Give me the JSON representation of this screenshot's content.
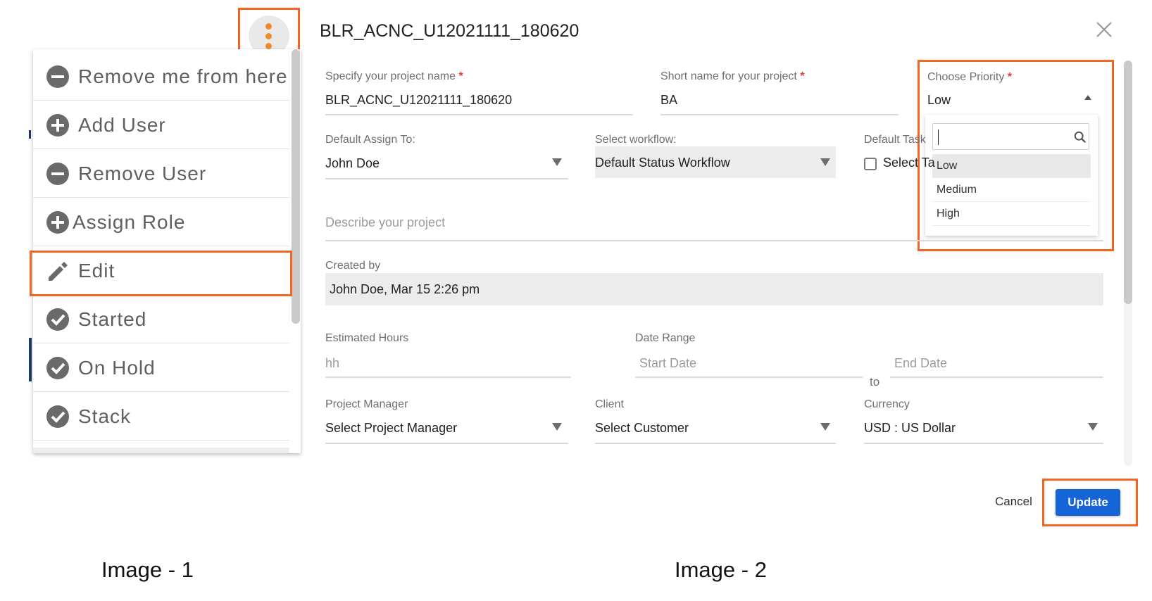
{
  "image1": {
    "caption": "Image - 1",
    "menu": {
      "items": [
        {
          "label": "Remove me from here",
          "icon": "minus-circle-icon"
        },
        {
          "label": "Add User",
          "icon": "plus-circle-icon"
        },
        {
          "label": "Remove User",
          "icon": "minus-circle-icon"
        },
        {
          "label": "Assign Role",
          "icon": "plus-circle-icon"
        },
        {
          "label": "Edit",
          "icon": "pencil-icon"
        },
        {
          "label": "Started",
          "icon": "check-circle-icon"
        },
        {
          "label": "On Hold",
          "icon": "check-circle-icon"
        },
        {
          "label": "Stack",
          "icon": "check-circle-icon"
        }
      ]
    }
  },
  "image2": {
    "caption": "Image - 2",
    "dialog": {
      "title": "BLR_ACNC_U12021111_180620",
      "project_name": {
        "label": "Specify your project name",
        "required": "*",
        "value": "BLR_ACNC_U12021111_180620"
      },
      "short_name": {
        "label": "Short name for your project",
        "required": "*",
        "value": "BA"
      },
      "priority": {
        "label": "Choose Priority",
        "required": "*",
        "value": "Low",
        "options": [
          "Low",
          "Medium",
          "High"
        ]
      },
      "assign_to": {
        "label": "Default Assign To:",
        "value": "John Doe"
      },
      "workflow": {
        "label": "Select workflow:",
        "value": "Default Status Workflow"
      },
      "default_task": {
        "label": "Default Task",
        "checkbox_label": "Select Ta"
      },
      "description": {
        "placeholder": "Describe your project"
      },
      "created_by": {
        "label": "Created by",
        "value": "John Doe, Mar 15 2:26 pm"
      },
      "estimated_hours": {
        "label": "Estimated Hours",
        "placeholder": "hh"
      },
      "date_range": {
        "label": "Date Range",
        "start_placeholder": "Start Date",
        "separator": "to",
        "end_placeholder": "End Date"
      },
      "project_manager": {
        "label": "Project Manager",
        "value": "Select Project Manager"
      },
      "client": {
        "label": "Client",
        "value": "Select Customer"
      },
      "currency": {
        "label": "Currency",
        "value": "USD : US Dollar"
      },
      "cancel_label": "Cancel",
      "update_label": "Update"
    }
  },
  "colors": {
    "highlight": "#f26522",
    "primary_button": "#1565d8",
    "kebab_dots": "#f18a2a",
    "required_star": "#e53935"
  }
}
